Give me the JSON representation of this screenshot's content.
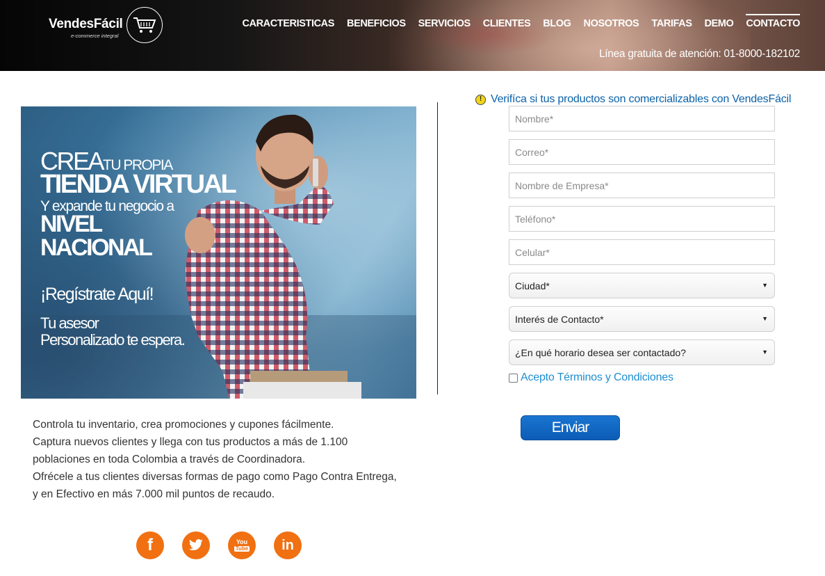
{
  "header": {
    "logo": {
      "name": "VendesFácil",
      "tagline": "e-commerce integral"
    },
    "nav": [
      {
        "label": "CARACTERISTICAS",
        "active": false
      },
      {
        "label": "BENEFICIOS",
        "active": false
      },
      {
        "label": "SERVICIOS",
        "active": false
      },
      {
        "label": "CLIENTES",
        "active": false
      },
      {
        "label": "BLOG",
        "active": false
      },
      {
        "label": "NOSOTROS",
        "active": false
      },
      {
        "label": "TARIFAS",
        "active": false
      },
      {
        "label": "DEMO",
        "active": false
      },
      {
        "label": "CONTACTO",
        "active": true
      }
    ],
    "hotline": "Línea gratuita de atención: 01-8000-182102"
  },
  "hero": {
    "line1_big": "CREA",
    "line1_small": "TU PROPIA",
    "line2": "TIENDA VIRTUAL",
    "line3": "Y expande tu negocio a",
    "line4": "NIVEL",
    "line5": "NACIONAL",
    "line6": "¡Regístrate Aquí!",
    "line7": "Tu asesor",
    "line8": "Personalizado te espera."
  },
  "description": [
    "Controla tu inventario, crea promociones y cupones fácilmente.",
    "Captura nuevos clientes y llega con tus productos a más de 1.100",
    "poblaciones en toda Colombia a través de Coordinadora.",
    "Ofrécele a tus clientes diversas formas de pago como Pago Contra Entrega,",
    "y en Efectivo en más 7.000 mil puntos de recaudo."
  ],
  "social": [
    {
      "icon": "facebook-icon",
      "glyph": "f"
    },
    {
      "icon": "twitter-icon"
    },
    {
      "icon": "youtube-icon",
      "top": "You",
      "bottom": "Tube"
    },
    {
      "icon": "linkedin-icon",
      "glyph": "in"
    }
  ],
  "form": {
    "verify_link": "Verifíca si tus productos son comercializables con VendesFácil",
    "fields": {
      "nombre": "Nombre*",
      "correo": "Correo*",
      "empresa": "Nombre de Empresa*",
      "telefono": "Teléfono*",
      "celular": "Celular*"
    },
    "selects": {
      "ciudad": "Ciudad*",
      "interes": "Interés de Contacto*",
      "horario": "¿En qué horario desea ser contactado?"
    },
    "terms_label": "Acepto Términos y Condiciones",
    "submit_label": "Enviar"
  },
  "colors": {
    "brand_blue": "#0b5cb5",
    "link_blue": "#0c62a8",
    "terms_blue": "#1e8fd0",
    "social_orange": "#f07012"
  }
}
